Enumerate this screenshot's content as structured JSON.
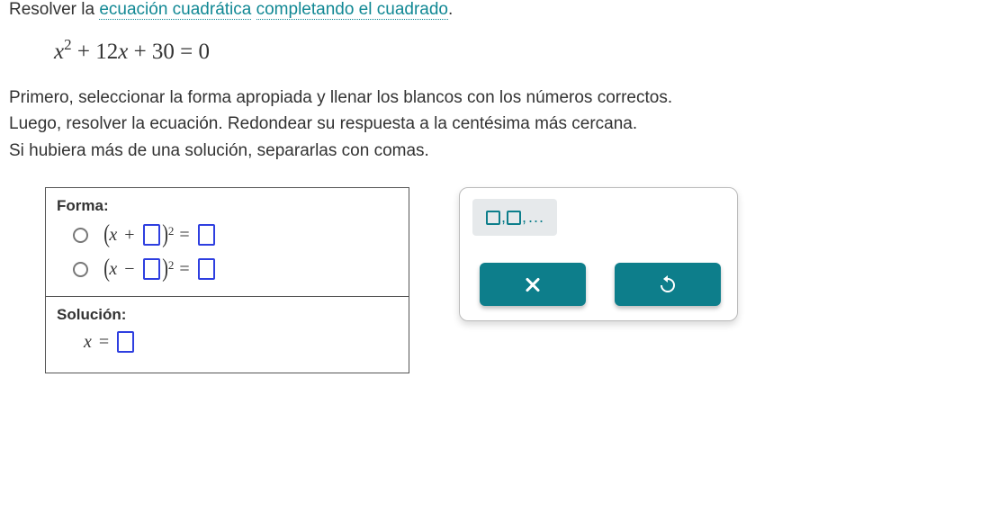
{
  "prompt": {
    "lead": "Resolver la ",
    "link1": "ecuación cuadrática",
    "mid": " ",
    "link2": "completando el cuadrado",
    "tail": "."
  },
  "equation": {
    "lhs_var": "x",
    "lhs_exp": "2",
    "term2": " + 12",
    "term2var": "x",
    "term3": " + 30 = 0"
  },
  "instructions": {
    "l1": "Primero, seleccionar la forma apropiada y llenar los blancos con los números correctos.",
    "l2": "Luego, resolver la ecuación. Redondear su respuesta a la centésima más cercana.",
    "l3": "Si hubiera más de una solución, separarlas con comas."
  },
  "form_section": {
    "label": "Forma:",
    "opt_plus_op": "+",
    "opt_minus_op": "−",
    "eq": "=",
    "exp": "2",
    "x": "x"
  },
  "solution_section": {
    "label": "Solución:",
    "x": "x",
    "eq": "="
  },
  "keypad": {
    "list_sep": ",",
    "list_dots": "..."
  }
}
